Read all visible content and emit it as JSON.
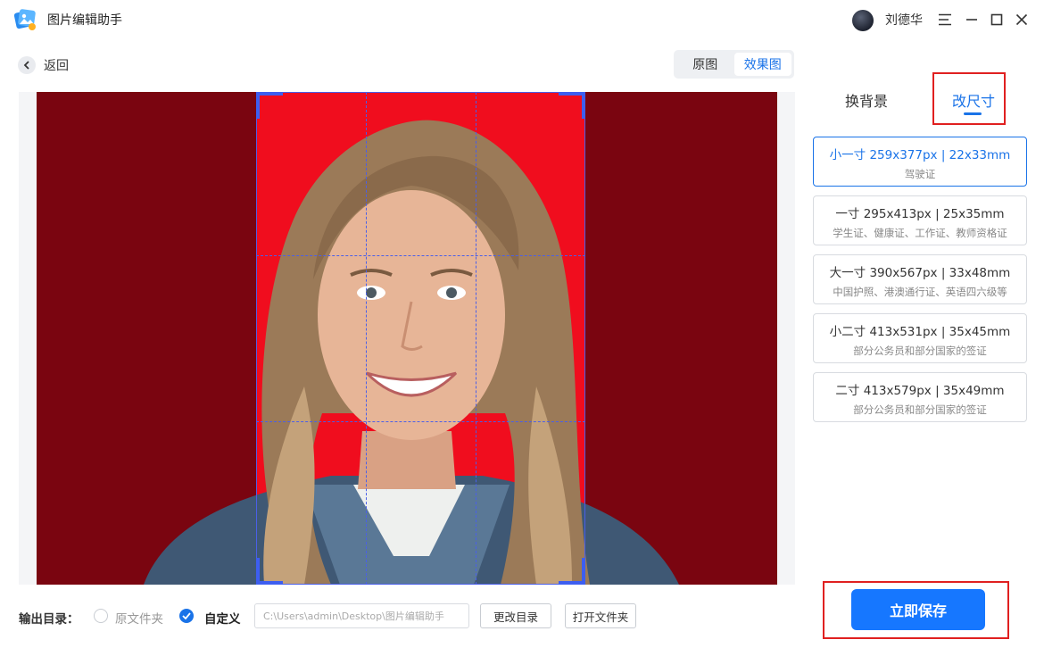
{
  "app": {
    "title": "图片编辑助手",
    "logo_icon": "app-logo-icon"
  },
  "user": {
    "name": "刘德华"
  },
  "window_controls": [
    "menu-icon",
    "minimize-icon",
    "maximize-icon",
    "close-icon"
  ],
  "toolbar": {
    "back_label": "返回",
    "view_options": [
      "原图",
      "效果图"
    ],
    "view_selected": "效果图"
  },
  "preview": {
    "background_color": "#7a0510",
    "crop_background_color": "#f00d1e",
    "grid_color": "#4a5fe8"
  },
  "panel": {
    "tabs": [
      "换背景",
      "改尺寸"
    ],
    "active_tab": "改尺寸",
    "sizes": [
      {
        "label": "小一寸 259x377px | 22x33mm",
        "desc": "驾驶证",
        "selected": true
      },
      {
        "label": "一寸 295x413px | 25x35mm",
        "desc": "学生证、健康证、工作证、教师资格证",
        "selected": false
      },
      {
        "label": "大一寸 390x567px | 33x48mm",
        "desc": "中国护照、港澳通行证、英语四六级等",
        "selected": false
      },
      {
        "label": "小二寸 413x531px | 35x45mm",
        "desc": "部分公务员和部分国家的签证",
        "selected": false
      },
      {
        "label": "二寸 413x579px | 35x49mm",
        "desc": "部分公务员和部分国家的签证",
        "selected": false
      }
    ],
    "save_label": "立即保存"
  },
  "output": {
    "label": "输出目录：",
    "option_original": "原文件夹",
    "option_custom": "自定义",
    "selected": "自定义",
    "path_value": "C:\\Users\\admin\\Desktop\\图片编辑助手",
    "change_dir_label": "更改目录",
    "open_folder_label": "打开文件夹"
  },
  "colors": {
    "accent": "#1a73e8",
    "primary_button": "#1677ff",
    "annotation_red": "#e02020"
  }
}
